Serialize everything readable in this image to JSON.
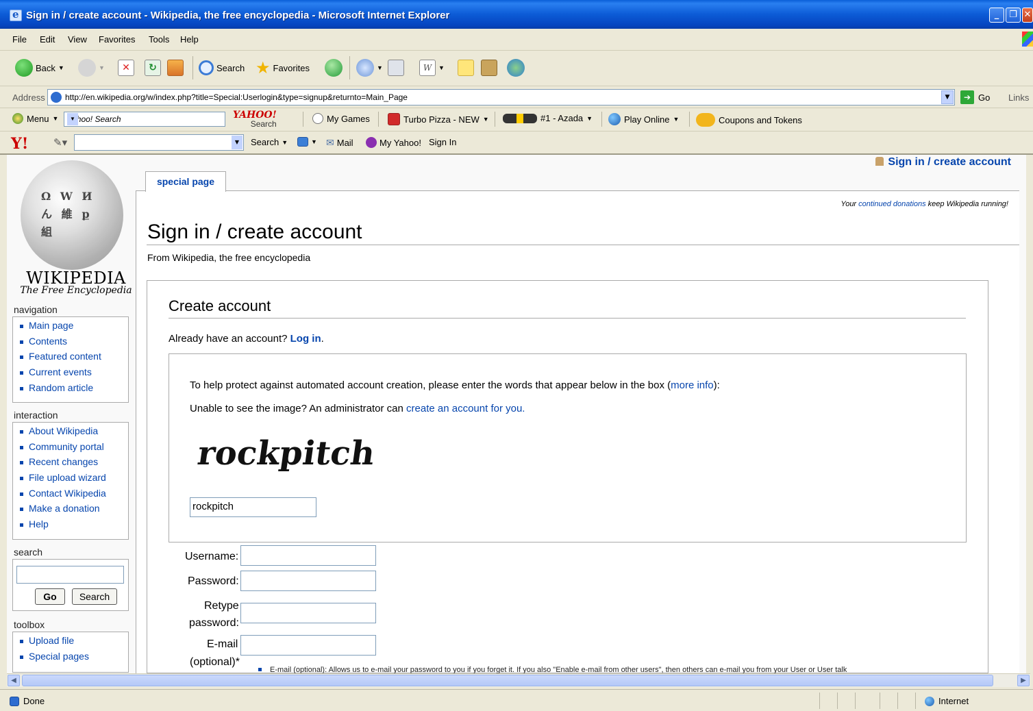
{
  "window": {
    "title": "Sign in / create account - Wikipedia, the free encyclopedia - Microsoft Internet Explorer"
  },
  "menu": [
    "File",
    "Edit",
    "View",
    "Favorites",
    "Tools",
    "Help"
  ],
  "toolbar": {
    "back_label": "Back",
    "search_label": "Search",
    "favorites_label": "Favorites"
  },
  "address": {
    "label": "Address",
    "url": "http://en.wikipedia.org/w/index.php?title=Special:Userlogin&type=signup&returnto=Main_Page",
    "go_label": "Go",
    "links_label": "Links"
  },
  "yahoo_bar": {
    "menu_label": "Menu",
    "search_placeholder": "Yahoo! Search",
    "brand_top": "YAHOO!",
    "brand_bottom": "Search",
    "my_games": "My Games",
    "turbo_pizza": "Turbo Pizza - NEW",
    "azada": "#1 - Azada",
    "play_online": "Play Online",
    "coupons": "Coupons and Tokens"
  },
  "yahoo_bar2": {
    "logo": "Y!",
    "search_label": "Search",
    "mail_label": "Mail",
    "my_yahoo_label": "My Yahoo!",
    "sign_in_label": "Sign In"
  },
  "wiki": {
    "logo_title": "WIKIPEDIA",
    "logo_subtitle": "The Free Encyclopedia",
    "tab": "special page",
    "user_link": "Sign in / create account",
    "donate_prefix": "Your ",
    "donate_link": "continued donations",
    "donate_suffix": " keep Wikipedia running!",
    "page_title": "Sign in / create account",
    "page_sub": "From Wikipedia, the free encyclopedia",
    "nav_heading": "navigation",
    "nav_items": [
      "Main page",
      "Contents",
      "Featured content",
      "Current events",
      "Random article"
    ],
    "interaction_heading": "interaction",
    "interaction_items": [
      "About Wikipedia",
      "Community portal",
      "Recent changes",
      "File upload wizard",
      "Contact Wikipedia",
      "Make a donation",
      "Help"
    ],
    "search_heading": "search",
    "go_btn": "Go",
    "search_btn": "Search",
    "toolbox_heading": "toolbox",
    "toolbox_items": [
      "Upload file",
      "Special pages"
    ]
  },
  "form": {
    "heading": "Create account",
    "already_text": "Already have an account? ",
    "login_link": "Log in",
    "captcha_text": "To help protect against automated account creation, please enter the words that appear below in the box (",
    "more_info_link": "more info",
    "captcha_text_end": "):",
    "unable_text": "Unable to see the image? An administrator can ",
    "create_for_you_link": "create an account for you.",
    "captcha_word": "rockpitch",
    "captcha_input_value": "rockpitch",
    "username_label": "Username:",
    "password_label": "Password:",
    "retype_label_1": "Retype",
    "retype_label_2": "password:",
    "email_label_1": "E-mail",
    "email_label_2": "(optional)*",
    "email_note": "E-mail (optional): Allows us to e-mail your password to you if you forget it. If you also \"Enable e-mail from other users\", then others can e-mail you from your User or User talk"
  },
  "status": {
    "done": "Done",
    "zone": "Internet"
  }
}
